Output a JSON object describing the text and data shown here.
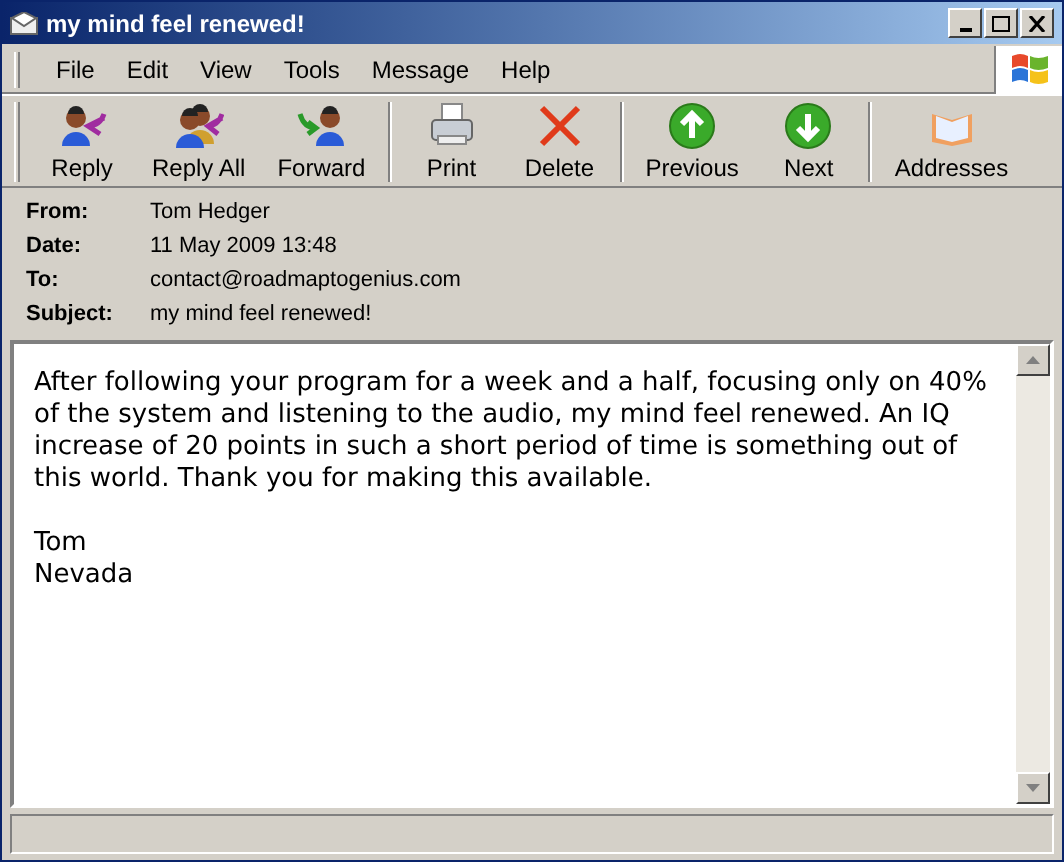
{
  "window": {
    "title": "my mind feel renewed!"
  },
  "menu": [
    "File",
    "Edit",
    "View",
    "Tools",
    "Message",
    "Help"
  ],
  "toolbar": [
    [
      {
        "label": "Reply",
        "kind": "reply"
      },
      {
        "label": "Reply All",
        "kind": "reply_all"
      },
      {
        "label": "Forward",
        "kind": "forward"
      }
    ],
    [
      {
        "label": "Print",
        "kind": "print"
      },
      {
        "label": "Delete",
        "kind": "delete"
      }
    ],
    [
      {
        "label": "Previous",
        "kind": "previous"
      },
      {
        "label": "Next",
        "kind": "next"
      }
    ],
    [
      {
        "label": "Addresses",
        "kind": "addresses"
      }
    ]
  ],
  "headers": [
    {
      "label": "From:",
      "value": "Tom Hedger"
    },
    {
      "label": "Date:",
      "value": "11 May 2009 13:48"
    },
    {
      "label": "To:",
      "value": "contact@roadmaptogenius.com"
    },
    {
      "label": "Subject:",
      "value": "my mind feel renewed!"
    }
  ],
  "body": [
    "After following your program for a week and a half, focusing only on 40% of the system and listening to the audio, my mind feel renewed. An IQ increase of 20 points in such a short period of time is something out of this world. Thank you for making this available.",
    "Tom\nNevada"
  ]
}
